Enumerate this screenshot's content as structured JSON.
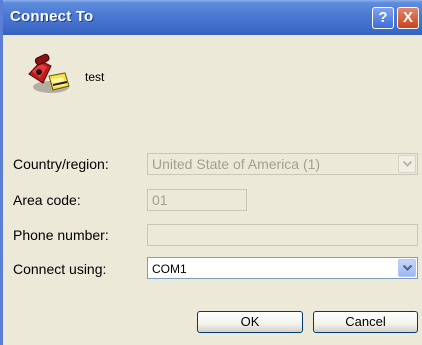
{
  "window": {
    "title": "Connect To"
  },
  "titlebar_buttons": {
    "help": "?",
    "close": "X"
  },
  "connection": {
    "name": "test",
    "icon": "phone-connection-icon"
  },
  "form": {
    "country_label": "Country/region:",
    "country_value": "United State of America (1)",
    "area_label": "Area code:",
    "area_value": "01",
    "phone_label": "Phone number:",
    "phone_value": "",
    "connect_label": "Connect using:",
    "connect_value": "COM1"
  },
  "buttons": {
    "ok": "OK",
    "cancel": "Cancel"
  },
  "colors": {
    "titlebar": "#3E6CC8",
    "dialog_bg": "#ECE9D8",
    "close_button": "#C8451F",
    "input_border": "#7F9DB9"
  }
}
